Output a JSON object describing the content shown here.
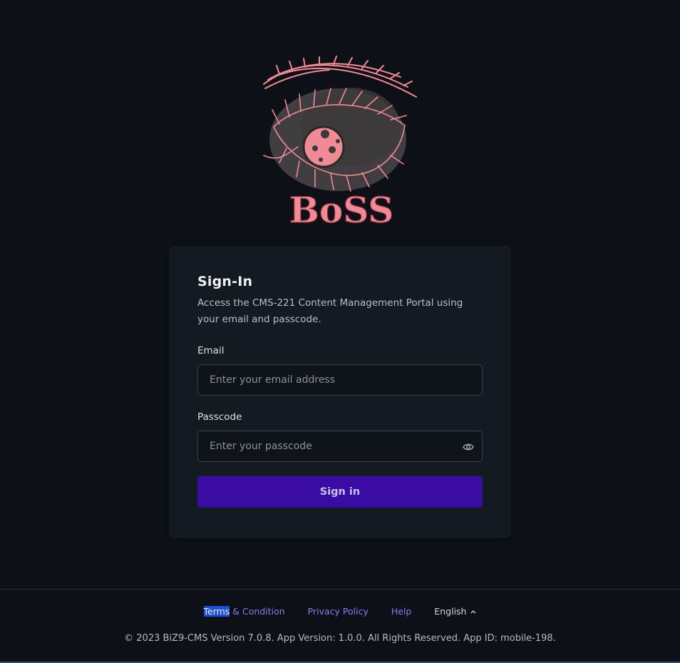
{
  "logo": {
    "brand_text": "BoSS",
    "accent_color": "#f08a94"
  },
  "card": {
    "title": "Sign-In",
    "subtitle": "Access the CMS-221 Content Management Portal using your email and passcode."
  },
  "email": {
    "label": "Email",
    "placeholder": "Enter your email address",
    "value": ""
  },
  "passcode": {
    "label": "Passcode",
    "placeholder": "Enter your passcode",
    "value": "",
    "toggle_icon": "eye-icon"
  },
  "signin": {
    "label": "Sign in",
    "color": "#3a0ca3"
  },
  "footer": {
    "terms_highlight": "Terms",
    "terms_rest": " & Condition",
    "privacy": "Privacy Policy",
    "help": "Help",
    "language": "English",
    "copyright": "© 2023 BiZ9-CMS Version 7.0.8. App Version: 1.0.0. All Rights Reserved. App ID: mobile-198."
  }
}
